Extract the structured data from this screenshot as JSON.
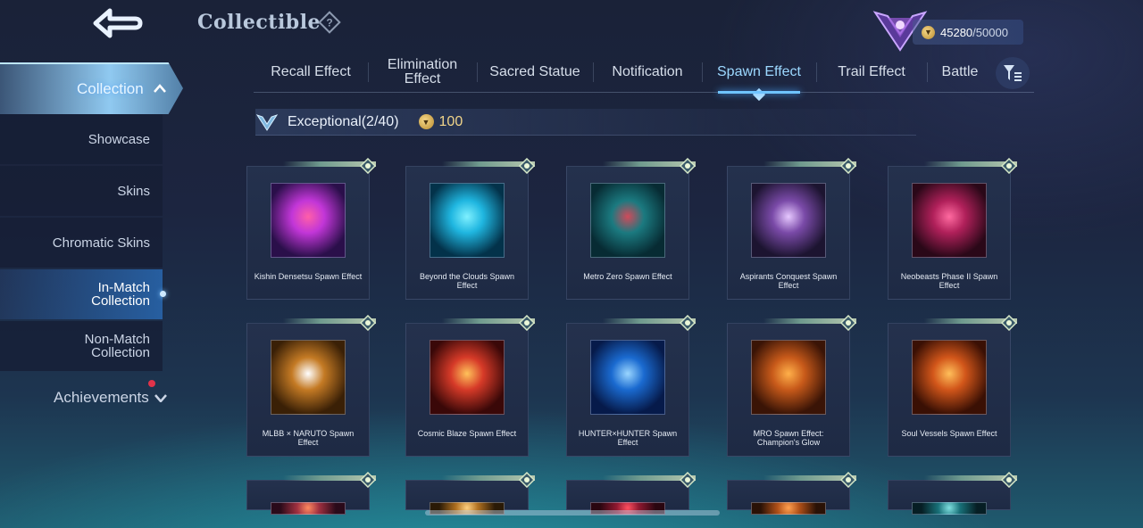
{
  "header": {
    "title": "Collectible",
    "help_symbol": "?",
    "currency": {
      "current": "45280",
      "max": "/50000",
      "icon": "coin-icon"
    },
    "rank_icon": "rank-emblem-icon"
  },
  "sidebar": {
    "collection_label": "Collection",
    "items": [
      {
        "label": "Showcase",
        "active": false
      },
      {
        "label": "Skins",
        "active": false
      },
      {
        "label": "Chromatic Skins",
        "active": false
      },
      {
        "label": "In-Match Collection",
        "active": true
      },
      {
        "label": "Non-Match Collection",
        "active": false
      }
    ],
    "achievements_label": "Achievements"
  },
  "tabs": [
    {
      "label": "Recall Effect",
      "active": false
    },
    {
      "label": "Elimination Effect",
      "active": false
    },
    {
      "label": "Sacred Statue",
      "active": false
    },
    {
      "label": "Notification",
      "active": false
    },
    {
      "label": "Spawn Effect",
      "active": true
    },
    {
      "label": "Trail Effect",
      "active": false
    },
    {
      "label": "Battle",
      "active": false
    }
  ],
  "section": {
    "title": "Exceptional(2/40)",
    "cost": "100"
  },
  "cards": [
    {
      "name": "Kishin Densetsu Spawn Effect",
      "colors": [
        "#2a0f4a",
        "#c236d8",
        "#ff5fa8"
      ]
    },
    {
      "name": "Beyond the Clouds Spawn Effect",
      "colors": [
        "#03324a",
        "#1fb6e0",
        "#7ff0ff"
      ]
    },
    {
      "name": "Metro Zero Spawn Effect",
      "colors": [
        "#072b33",
        "#1b7a80",
        "#d04a5a"
      ]
    },
    {
      "name": "Aspirants Conquest Spawn Effect",
      "colors": [
        "#1c1430",
        "#7a4aa8",
        "#e6c8ff"
      ]
    },
    {
      "name": "Neobeasts Phase II Spawn Effect",
      "colors": [
        "#2a0818",
        "#b0205a",
        "#ff6aa0"
      ]
    },
    {
      "name": "MLBB × NARUTO Spawn Effect",
      "colors": [
        "#3a2006",
        "#c47a24",
        "#ffffff"
      ]
    },
    {
      "name": "Cosmic Blaze Spawn Effect",
      "colors": [
        "#3a0808",
        "#d63a28",
        "#ffc25a"
      ]
    },
    {
      "name": "HUNTER×HUNTER Spawn Effect",
      "colors": [
        "#061a4a",
        "#1a6ad0",
        "#9ad6ff"
      ]
    },
    {
      "name": "MRO Spawn Effect: Champion's Glow",
      "colors": [
        "#3a1406",
        "#c85a1a",
        "#ffb04a"
      ]
    },
    {
      "name": "Soul Vessels Spawn Effect",
      "colors": [
        "#3a1004",
        "#d2561a",
        "#ffbf5a"
      ]
    },
    {
      "name": "",
      "colors": [
        "#2a0a1a",
        "#a03040",
        "#ff8a60"
      ]
    },
    {
      "name": "",
      "colors": [
        "#2a1a06",
        "#b07020",
        "#ffd080"
      ]
    },
    {
      "name": "",
      "colors": [
        "#2a0610",
        "#901830",
        "#ff5060"
      ]
    },
    {
      "name": "",
      "colors": [
        "#2a1206",
        "#b05018",
        "#ffa050"
      ]
    },
    {
      "name": "",
      "colors": [
        "#061e24",
        "#187078",
        "#80e0e0"
      ]
    }
  ],
  "icons": {
    "back": "back-arrow-icon",
    "help": "help-icon",
    "filter": "filter-icon",
    "section": "exceptional-tier-icon",
    "chevron_up": "chevron-up-icon",
    "chevron_down": "chevron-down-icon"
  },
  "colors": {
    "accent": "#6fc4ff",
    "gold": "#f1d58a",
    "notification_dot": "#e0334a"
  }
}
